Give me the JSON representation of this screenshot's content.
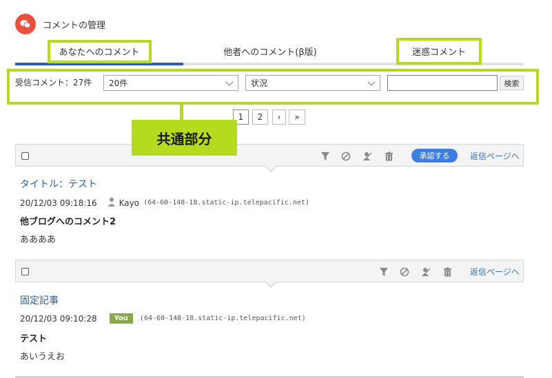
{
  "header": {
    "title": "コメントの管理",
    "icon": "comment-bubbles-icon",
    "icon_color": "#e8503f"
  },
  "tabs": [
    {
      "label": "あなたへのコメント",
      "active": true
    },
    {
      "label": "他者へのコメント(β版)",
      "active": false
    },
    {
      "label": "迷惑コメント",
      "active": false
    }
  ],
  "annotation": {
    "label": "共通部分",
    "color": "#b5db1f"
  },
  "filter": {
    "received_label": "受信コメント：27件",
    "per_page_value": "20件",
    "status_value": "状況",
    "search_value": "",
    "search_button": "検索"
  },
  "pagination": {
    "pages": [
      "1",
      "2"
    ],
    "current": "1",
    "next": "›",
    "last": "»"
  },
  "comments": [
    {
      "title": "タイトル：テスト",
      "datetime": "20/12/03 09:18:16",
      "author": "Kayo",
      "host": "(64-60-148-18.static-ip.telepacific.net)",
      "subject": "他ブログへのコメント2",
      "body": "ああああ",
      "approve_label": "承認する",
      "reply_label": "返信ページへ"
    },
    {
      "title": "固定記事",
      "datetime": "20/12/03 09:10:28",
      "badge": "You",
      "host": "(64-60-148-18.static-ip.telepacific.net)",
      "subject": "テスト",
      "body": "あいうえお",
      "reply_label": "返信ページへ"
    }
  ],
  "colors": {
    "accent": "#2f5ea7",
    "link": "#3d6fb4",
    "approve": "#3d7ee0",
    "you_badge": "#8aaa47"
  }
}
